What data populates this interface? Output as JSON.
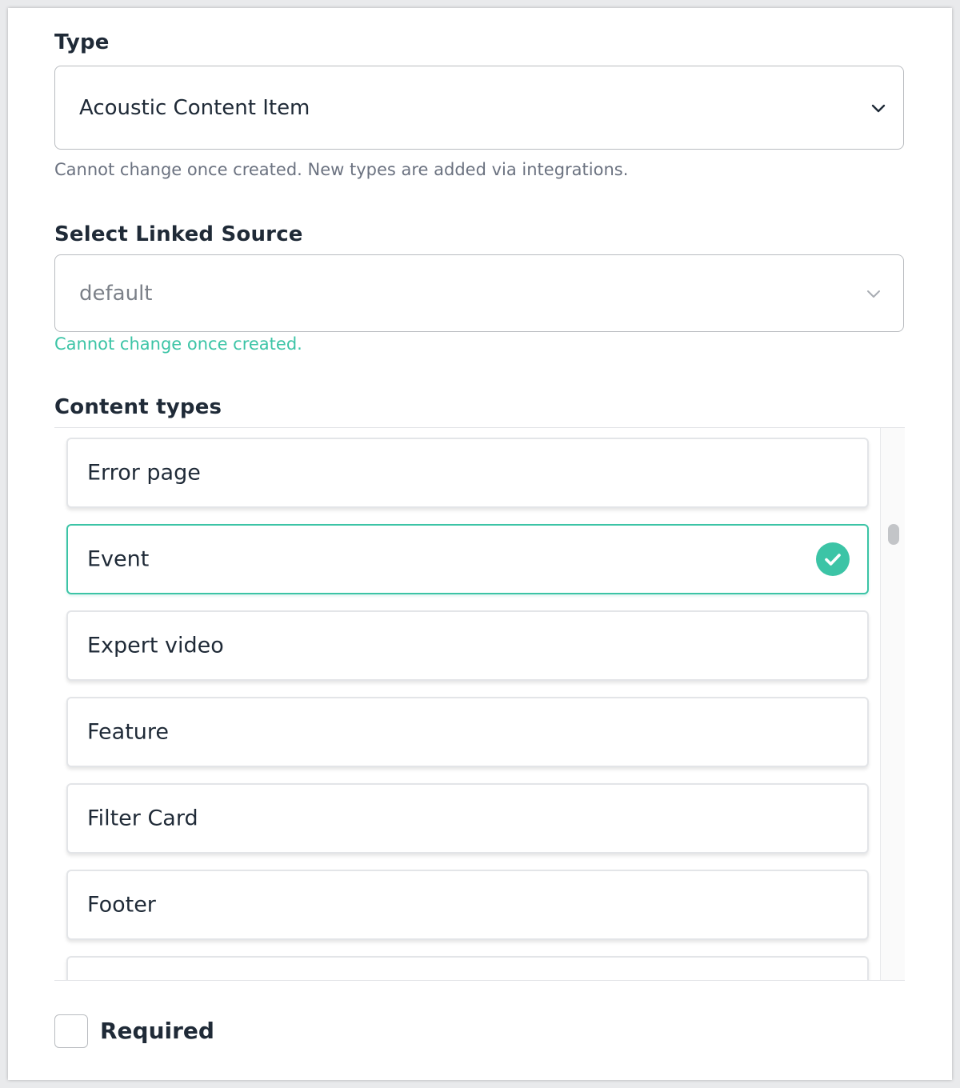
{
  "type_field": {
    "label": "Type",
    "value": "Acoustic Content Item",
    "help": "Cannot change once created. New types are added via integrations."
  },
  "linked_source": {
    "label": "Select Linked Source",
    "value": "default",
    "help": "Cannot change once created."
  },
  "content_types": {
    "label": "Content types",
    "items": [
      {
        "label": "Error page",
        "selected": false
      },
      {
        "label": "Event",
        "selected": true
      },
      {
        "label": "Expert video",
        "selected": false
      },
      {
        "label": "Feature",
        "selected": false
      },
      {
        "label": "Filter Card",
        "selected": false
      },
      {
        "label": "Footer",
        "selected": false
      },
      {
        "label": "",
        "selected": false
      }
    ]
  },
  "required": {
    "label": "Required",
    "checked": false
  },
  "colors": {
    "accent": "#3cc4a6",
    "text": "#1f2a37",
    "muted": "#6b7280",
    "border": "#b9bcc0"
  },
  "icons": {
    "dropdown": "chevron-down-icon",
    "selected": "checkmark-circle-icon"
  }
}
